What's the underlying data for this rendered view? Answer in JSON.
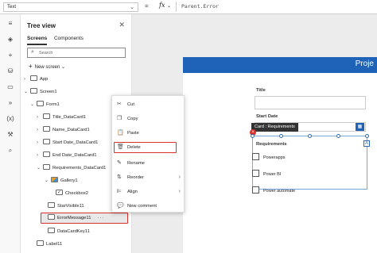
{
  "formula_bar": {
    "property": "Text",
    "equals": "=",
    "fx": "fx",
    "formula": "Parent.Error"
  },
  "tree_view": {
    "title": "Tree view",
    "tabs": [
      "Screens",
      "Components"
    ],
    "search_placeholder": "Search",
    "new_screen": "New screen",
    "nodes": {
      "app": "App",
      "screen1": "Screen1",
      "form1": "Form1",
      "title_card": "Title_DataCard1",
      "name_card": "Name_DataCard1",
      "start_card": "Start Date_DataCard1",
      "end_card": "End Date_DataCard1",
      "req_card": "Requirements_DataCard1",
      "gallery1": "Gallery1",
      "checkbox2": "Checkbox2",
      "starvisible": "StarVisible11",
      "errormessage": "ErrorMessage11",
      "datacardkey": "DataCardKey11",
      "label1": "Label11"
    },
    "more": "···"
  },
  "context_menu": {
    "items": {
      "cut": "Cut",
      "copy": "Copy",
      "paste": "Paste",
      "delete": "Delete",
      "rename": "Rename",
      "reorder": "Reorder",
      "align": "Align",
      "new_comment": "New comment"
    }
  },
  "canvas": {
    "header_title": "Proje",
    "title_label": "Title",
    "start_date_label": "Start Date",
    "tooltip": "Card : Requirements",
    "requirements_label": "Requirements",
    "checkboxes": [
      "Powerapps",
      "Power BI",
      "Power automate"
    ]
  },
  "colors": {
    "accent": "#1e63b8",
    "highlight": "#d9302a"
  }
}
